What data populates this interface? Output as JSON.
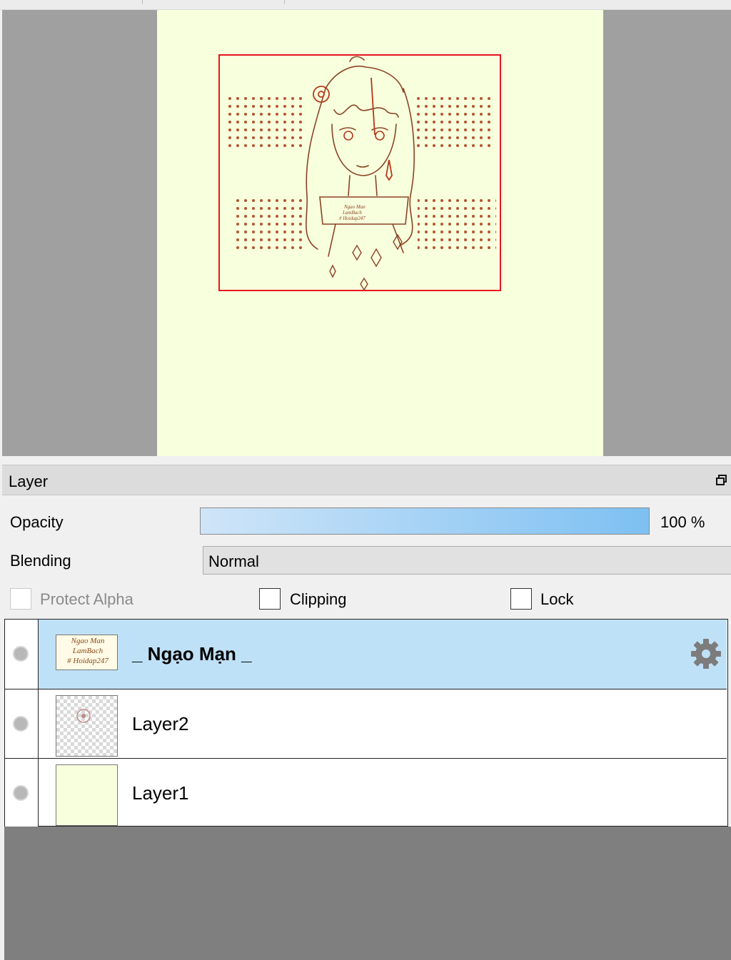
{
  "navigator": {
    "canvas_color": "#f8ffdd",
    "viewport_color": "#e4161f",
    "artwork_caption": [
      "Ngao Man",
      "LamBach",
      "# Hoidap247"
    ]
  },
  "layer_panel": {
    "title": "Layer",
    "float_icon": "restore-window-icon",
    "opacity": {
      "label": "Opacity",
      "value_text": "100 %",
      "value": 100
    },
    "blending": {
      "label": "Blending",
      "value": "Normal"
    },
    "options": {
      "protect_alpha": {
        "label": "Protect Alpha",
        "checked": false,
        "enabled": false
      },
      "clipping": {
        "label": "Clipping",
        "checked": false,
        "enabled": true
      },
      "lock": {
        "label": "Lock",
        "checked": false,
        "enabled": true
      }
    },
    "layers": [
      {
        "name": "_ Ngạo Mạn _",
        "selected": true,
        "thumb_text": [
          "Ngao Man",
          "LamBach",
          "# Hoidap247"
        ],
        "icon": "gear-icon"
      },
      {
        "name": "Layer2",
        "selected": false
      },
      {
        "name": "Layer1",
        "selected": false
      }
    ]
  }
}
